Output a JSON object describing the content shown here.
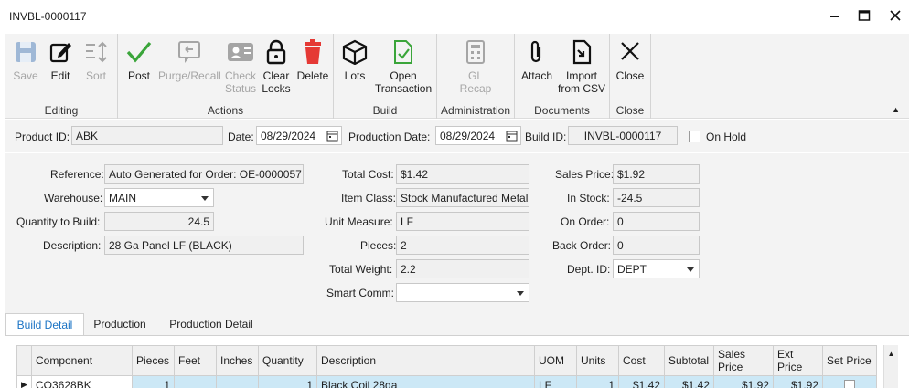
{
  "window": {
    "title": "INVBL-0000117"
  },
  "ribbon": {
    "groups": {
      "editing": "Editing",
      "actions": "Actions",
      "build": "Build",
      "administration": "Administration",
      "documents": "Documents",
      "close": "Close"
    },
    "buttons": {
      "save": "Save",
      "edit": "Edit",
      "sort": "Sort",
      "post": "Post",
      "purge1": "Purge/Recall",
      "check1": "Check",
      "check2": "Status",
      "clear1": "Clear",
      "clear2": "Locks",
      "delete": "Delete",
      "lots": "Lots",
      "open1": "Open",
      "open2": "Transaction",
      "gl1": "GL",
      "gl2": "Recap",
      "attach": "Attach",
      "import1": "Import",
      "import2": "from CSV",
      "close": "Close"
    },
    "colors": {
      "post": "#3aa53a",
      "delete": "#e53935",
      "disabled": "#a5a5a5"
    }
  },
  "header": {
    "product_id_label": "Product ID:",
    "product_id": "ABK",
    "date_label": "Date:",
    "date": "08/29/2024",
    "production_date_label": "Production Date:",
    "production_date": "08/29/2024",
    "build_id_label": "Build ID:",
    "build_id": "INVBL-0000117",
    "on_hold_label": "On Hold"
  },
  "form": {
    "reference_label": "Reference:",
    "reference": "Auto Generated for Order: OE-0000057",
    "warehouse_label": "Warehouse:",
    "warehouse": "MAIN",
    "qty_label": "Quantity to Build:",
    "qty": "24.5",
    "description_label": "Description:",
    "description": "28 Ga Panel LF (BLACK)",
    "total_cost_label": "Total Cost:",
    "total_cost": "$1.42",
    "item_class_label": "Item Class:",
    "item_class": "Stock Manufactured Metal",
    "unit_measure_label": "Unit Measure:",
    "unit_measure": "LF",
    "pieces_label": "Pieces:",
    "pieces": "2",
    "total_weight_label": "Total Weight:",
    "total_weight": "2.2",
    "smart_comm_label": "Smart Comm:",
    "smart_comm": "",
    "sales_price_label": "Sales Price:",
    "sales_price": "$1.92",
    "in_stock_label": "In Stock:",
    "in_stock": "-24.5",
    "on_order_label": "On Order:",
    "on_order": "0",
    "back_order_label": "Back Order:",
    "back_order": "0",
    "dept_label": "Dept. ID:",
    "dept": "DEPT"
  },
  "tabs": [
    "Build Detail",
    "Production",
    "Production Detail"
  ],
  "grid": {
    "columns": [
      "Component",
      "Pieces",
      "Feet",
      "Inches",
      "Quantity",
      "Description",
      "UOM",
      "Units",
      "Cost",
      "Subtotal",
      "Sales Price",
      "Ext Price",
      "Set Price"
    ],
    "rows": [
      [
        "CO3628BK",
        "1",
        "",
        "",
        "1",
        "Black Coil 28ga",
        "LF",
        "1",
        "$1.42",
        "$1.42",
        "$1.92",
        "$1.92",
        ""
      ]
    ]
  }
}
